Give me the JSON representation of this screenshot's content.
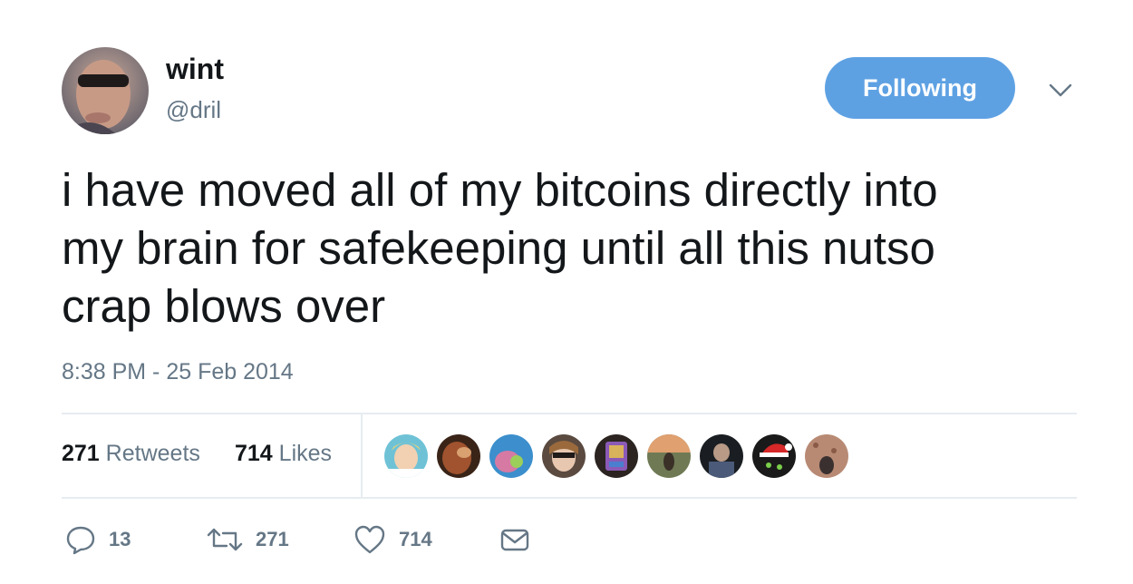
{
  "author": {
    "display_name": "wint",
    "handle": "@dril"
  },
  "follow_button": {
    "label": "Following",
    "color": "#5ea1e3"
  },
  "menu": {
    "icon": "chevron-down-icon"
  },
  "tweet": {
    "lines": [
      "i have moved all of my bitcoins directly into",
      "my brain for safekeeping until all this nutso",
      "crap blows over"
    ],
    "timestamp": "8:38 PM - 25 Feb 2014"
  },
  "stats": {
    "retweets": {
      "count": "271",
      "label": "Retweets"
    },
    "likes": {
      "count": "714",
      "label": "Likes"
    }
  },
  "likers": [
    {
      "name": "liker-avatar-1"
    },
    {
      "name": "liker-avatar-2"
    },
    {
      "name": "liker-avatar-3"
    },
    {
      "name": "liker-avatar-4"
    },
    {
      "name": "liker-avatar-5"
    },
    {
      "name": "liker-avatar-6"
    },
    {
      "name": "liker-avatar-7"
    },
    {
      "name": "liker-avatar-8"
    },
    {
      "name": "liker-avatar-9"
    }
  ],
  "actions": {
    "reply": {
      "icon": "reply-icon",
      "count": "13"
    },
    "retweet": {
      "icon": "retweet-icon",
      "count": "271"
    },
    "like": {
      "icon": "heart-icon",
      "count": "714"
    },
    "message": {
      "icon": "envelope-icon"
    }
  },
  "colors": {
    "text": "#14171a",
    "secondary": "#657786",
    "divider": "#e6ecf0"
  }
}
